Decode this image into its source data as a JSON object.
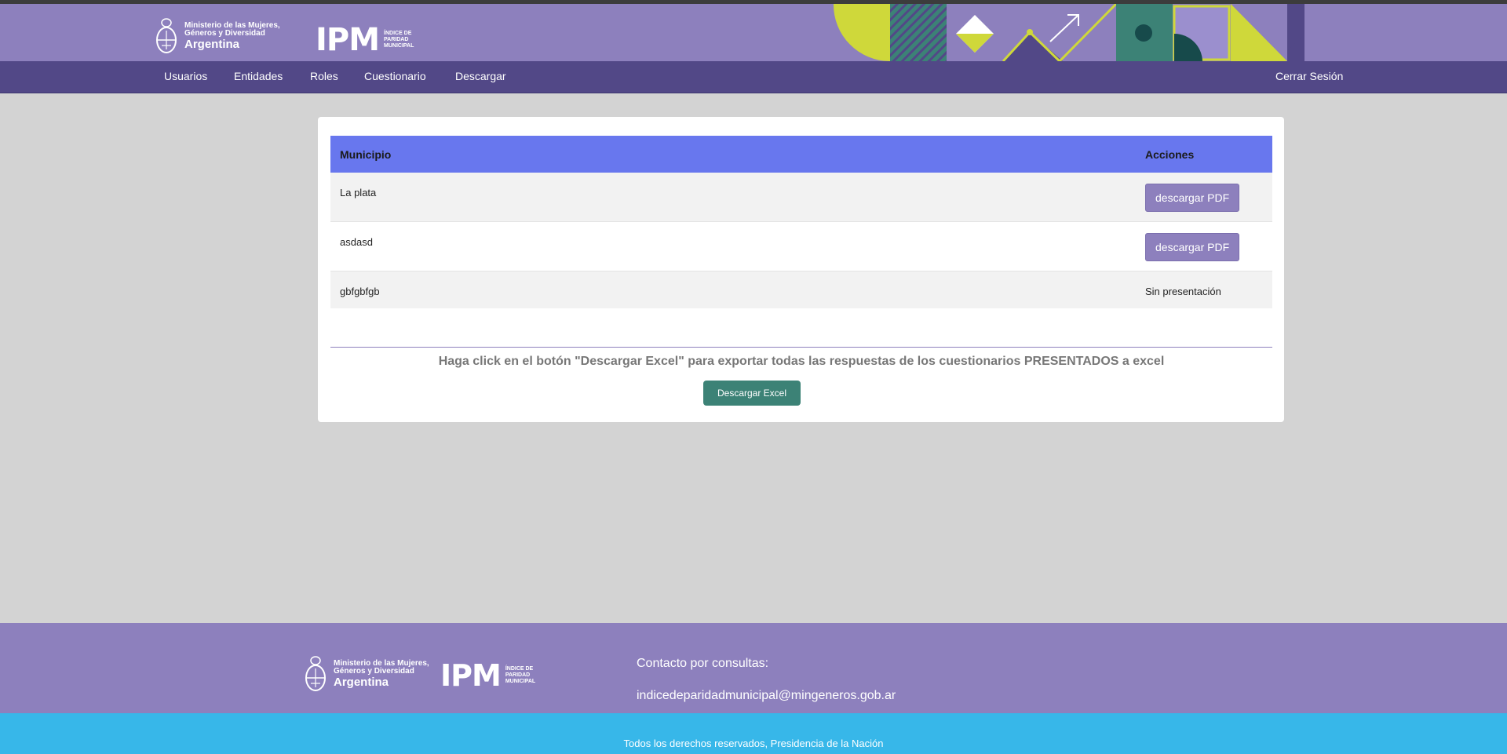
{
  "header": {
    "ministry": {
      "line1": "Ministerio de las Mujeres,",
      "line2": "Géneros y Diversidad",
      "country": "Argentina"
    },
    "ipm": {
      "acronym": "IPM",
      "sub1": "ÍNDICE DE",
      "sub2": "PARIDAD",
      "sub3": "MUNICIPAL"
    }
  },
  "nav": {
    "items": [
      {
        "label": "Usuarios"
      },
      {
        "label": "Entidades"
      },
      {
        "label": "Roles"
      },
      {
        "label": "Cuestionario"
      },
      {
        "label": "Descargar"
      }
    ],
    "logout": "Cerrar Sesión"
  },
  "table": {
    "headers": {
      "municipio": "Municipio",
      "acciones": "Acciones"
    },
    "rows": [
      {
        "municipio": "La plata",
        "action": "descargar PDF"
      },
      {
        "municipio": "asdasd",
        "action": "descargar PDF"
      },
      {
        "municipio": "gbfgbfgb",
        "action": "Sin presentación"
      }
    ]
  },
  "export": {
    "note": "Haga click en el botón \"Descargar Excel\" para exportar todas las respuestas de los cuestionarios PRESENTADOS a excel",
    "button": "Descargar Excel"
  },
  "footer": {
    "contact_label": "Contacto por consultas:",
    "email": "indicedeparidadmunicipal@mingeneros.gob.ar",
    "rights": "Todos los derechos reservados, Presidencia de la Nación"
  },
  "colors": {
    "brand_purple": "#8d80bd",
    "nav_purple": "#524887",
    "table_header": "#6877ee",
    "excel_green": "#3c8276",
    "footer_blue": "#37b7e9",
    "accent_yellow": "#cfd83a"
  }
}
